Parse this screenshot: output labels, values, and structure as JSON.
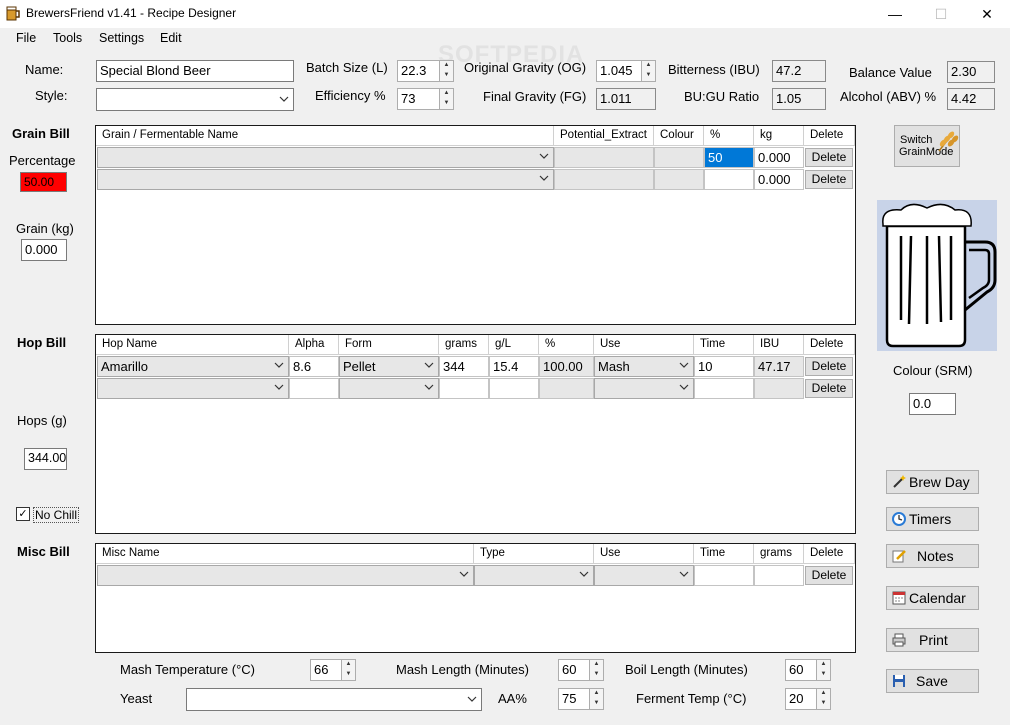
{
  "window": {
    "title": "BrewersFriend v1.41 - Recipe Designer",
    "minimize": "—",
    "maximize": "☐",
    "close": "✕"
  },
  "watermark": "SOFTPEDIA",
  "menu": [
    "File",
    "Tools",
    "Settings",
    "Edit"
  ],
  "recipe": {
    "name_label": "Name:",
    "name_value": "Special Blond Beer",
    "style_label": "Style:",
    "style_value": "",
    "batch_label": "Batch Size (L)",
    "batch_value": "22.3",
    "eff_label": "Efficiency %",
    "eff_value": "73",
    "og_label": "Original Gravity (OG)",
    "og_value": "1.045",
    "fg_label": "Final Gravity (FG)",
    "fg_value": "1.011",
    "ibu_label": "Bitterness (IBU)",
    "ibu_value": "47.2",
    "bugu_label": "BU:GU Ratio",
    "bugu_value": "1.05",
    "balance_label": "Balance Value",
    "balance_value": "2.30",
    "abv_label": "Alcohol (ABV) %",
    "abv_value": "4.42"
  },
  "grain": {
    "title": "Grain Bill",
    "pct_label": "Percentage",
    "pct_value": "50.00",
    "kg_label": "Grain (kg)",
    "kg_value": "0.000",
    "headers": [
      "Grain / Fermentable Name",
      "Potential_Extract",
      "Colour",
      "%",
      "kg",
      "Delete"
    ],
    "rows": [
      {
        "name": "",
        "extract": "",
        "colour": "",
        "pct": "50",
        "kg": "0.000",
        "delete": "Delete"
      },
      {
        "name": "",
        "extract": "",
        "colour": "",
        "pct": "",
        "kg": "0.000",
        "delete": "Delete"
      }
    ]
  },
  "hop": {
    "title": "Hop Bill",
    "hops_label": "Hops (g)",
    "hops_value": "344.00",
    "nochill": "No Chill",
    "headers": [
      "Hop Name",
      "Alpha",
      "Form",
      "grams",
      "g/L",
      "%",
      "Use",
      "Time",
      "IBU",
      "Delete"
    ],
    "rows": [
      {
        "name": "Amarillo",
        "alpha": "8.6",
        "form": "Pellet",
        "grams": "344",
        "gl": "15.4",
        "pct": "100.00",
        "use": "Mash",
        "time": "10",
        "ibu": "47.17",
        "delete": "Delete"
      },
      {
        "name": "",
        "alpha": "",
        "form": "",
        "grams": "",
        "gl": "",
        "pct": "",
        "use": "",
        "time": "",
        "ibu": "",
        "delete": "Delete"
      }
    ]
  },
  "misc": {
    "title": "Misc Bill",
    "headers": [
      "Misc Name",
      "Type",
      "Use",
      "Time",
      "grams",
      "Delete"
    ],
    "rows": [
      {
        "name": "",
        "type": "",
        "use": "",
        "time": "",
        "grams": "",
        "delete": "Delete"
      }
    ]
  },
  "bottom": {
    "mash_temp_label": "Mash Temperature (°C)",
    "mash_temp_value": "66",
    "mash_len_label": "Mash Length (Minutes)",
    "mash_len_value": "60",
    "boil_len_label": "Boil Length (Minutes)",
    "boil_len_value": "60",
    "yeast_label": "Yeast",
    "yeast_value": "",
    "aa_label": "AA%",
    "aa_value": "75",
    "ferment_label": "Ferment Temp (°C)",
    "ferment_value": "20"
  },
  "side": {
    "switch_label_1": "Switch",
    "switch_label_2": "GrainMode",
    "colour_label": "Colour (SRM)",
    "colour_value": "0.0",
    "buttons": [
      "Brew Day",
      "Timers",
      "Notes",
      "Calendar",
      "Print",
      "Save"
    ]
  },
  "colors": {
    "alert": "#ff0000",
    "selection": "#0078d7",
    "mug_bg": "#c8d3e8"
  }
}
